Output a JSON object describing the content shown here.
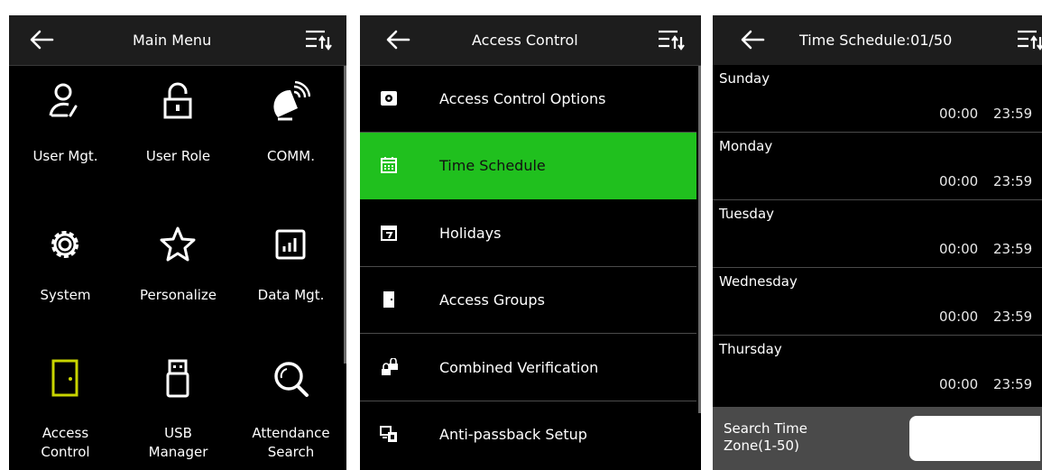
{
  "main_menu": {
    "title": "Main Menu",
    "items": [
      {
        "label": "User Mgt.",
        "icon": "user-icon"
      },
      {
        "label": "User Role",
        "icon": "lock-icon"
      },
      {
        "label": "COMM.",
        "icon": "satellite-icon"
      },
      {
        "label": "System",
        "icon": "gear-icon"
      },
      {
        "label": "Personalize",
        "icon": "star-icon"
      },
      {
        "label": "Data Mgt.",
        "icon": "chart-icon"
      },
      {
        "label": "Access\nControl",
        "icon": "door-icon"
      },
      {
        "label": "USB\nManager",
        "icon": "usb-icon"
      },
      {
        "label": "Attendance\nSearch",
        "icon": "search-icon"
      }
    ]
  },
  "access_control": {
    "title": "Access Control",
    "items": [
      {
        "label": "Access Control Options",
        "icon": "options-icon"
      },
      {
        "label": "Time Schedule",
        "icon": "calendar-icon",
        "active": true
      },
      {
        "label": "Holidays",
        "icon": "holiday-calendar-icon"
      },
      {
        "label": "Access Groups",
        "icon": "group-door-icon"
      },
      {
        "label": "Combined Verification",
        "icon": "combined-locks-icon"
      },
      {
        "label": "Anti-passback Setup",
        "icon": "anti-passback-icon"
      }
    ]
  },
  "time_schedule": {
    "title": "Time Schedule:01/50",
    "days": [
      {
        "day": "Sunday",
        "start": "00:00",
        "end": "23:59"
      },
      {
        "day": "Monday",
        "start": "00:00",
        "end": "23:59"
      },
      {
        "day": "Tuesday",
        "start": "00:00",
        "end": "23:59"
      },
      {
        "day": "Wednesday",
        "start": "00:00",
        "end": "23:59"
      },
      {
        "day": "Thursday",
        "start": "00:00",
        "end": "23:59"
      }
    ],
    "search_label": "Search Time\nZone(1-50)",
    "search_value": ""
  },
  "colors": {
    "accent": "#20c01e",
    "door": "#c8d400",
    "header_bg": "#1d1d1d"
  }
}
